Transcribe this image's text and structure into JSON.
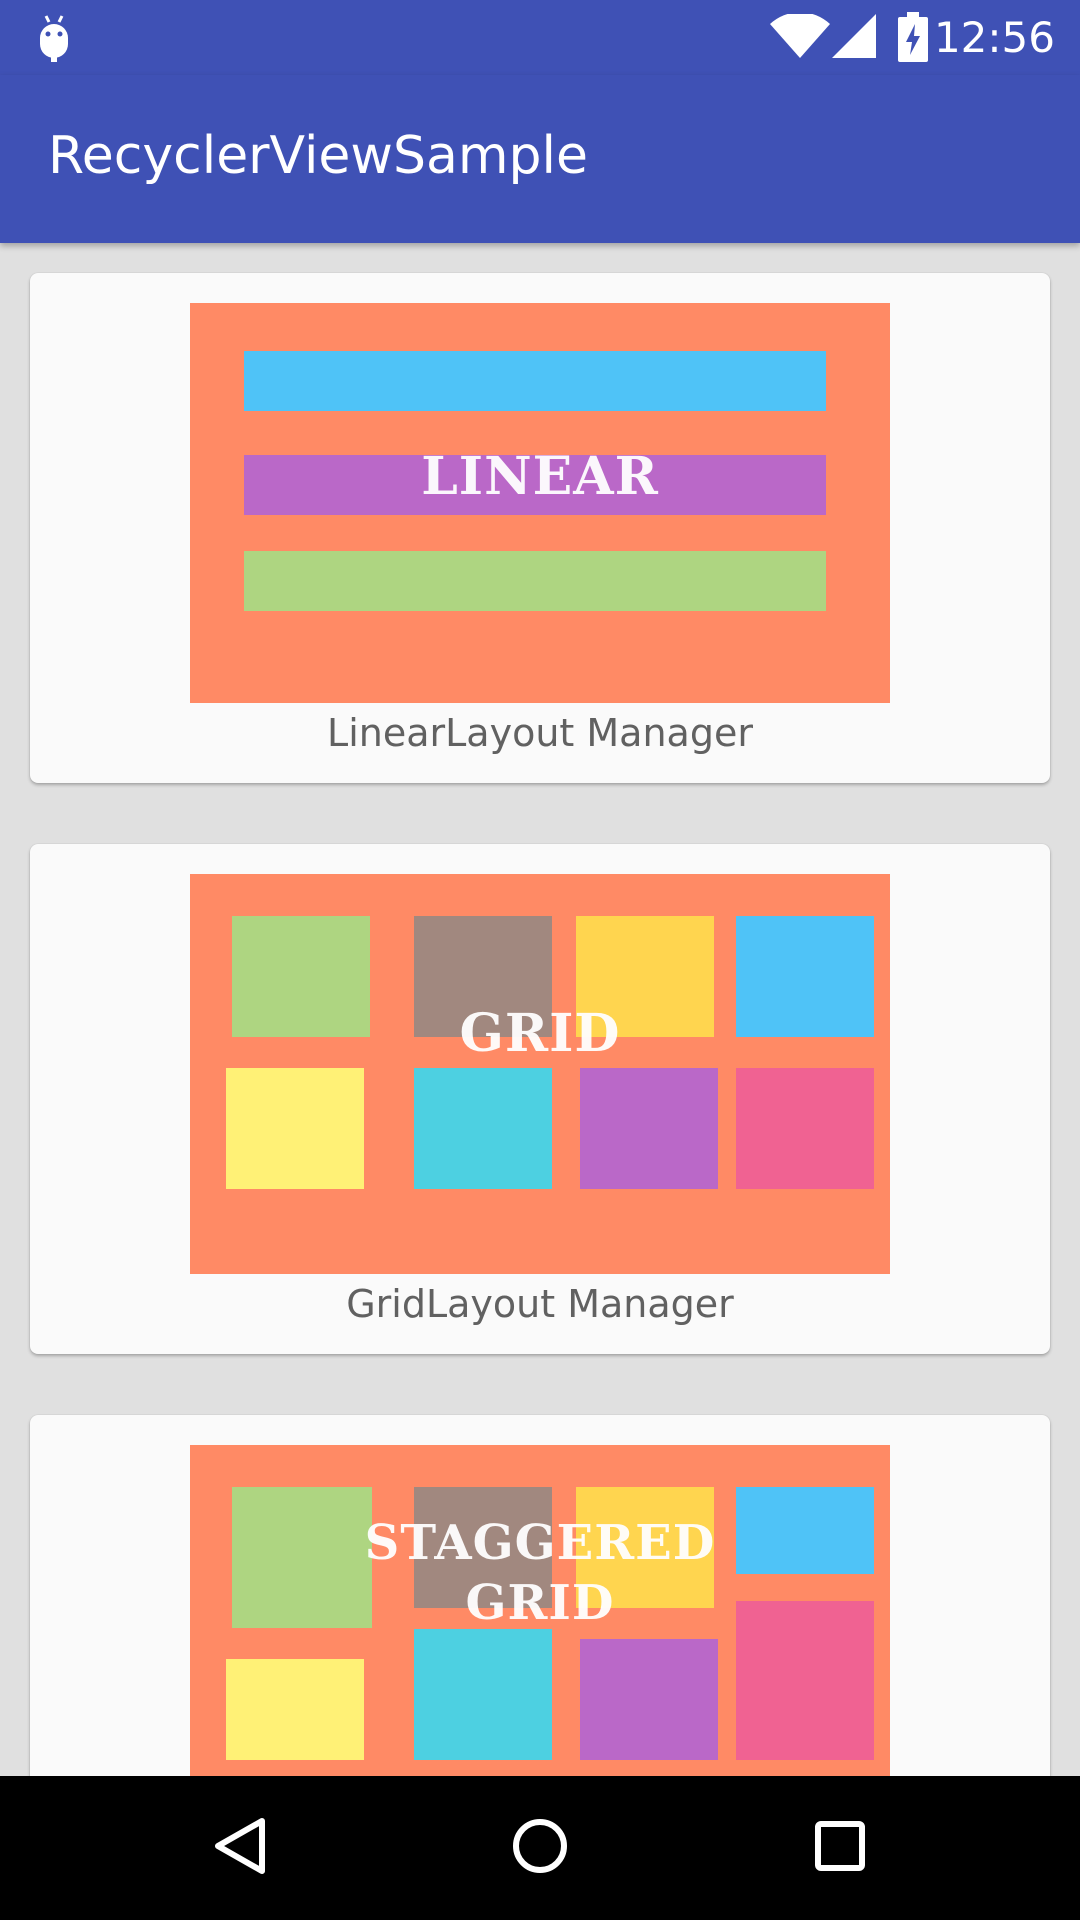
{
  "status_bar": {
    "time": "12:56",
    "icons": [
      "android-debug-icon",
      "wifi-icon",
      "cellular-signal-icon",
      "battery-charging-icon"
    ]
  },
  "app_bar": {
    "title": "RecyclerViewSample"
  },
  "cards": [
    {
      "thumbnail_label": "LINEAR",
      "caption": "LinearLayout Manager"
    },
    {
      "thumbnail_label": "GRID",
      "caption": "GridLayout Manager"
    },
    {
      "thumbnail_label_line1": "STAGGERED",
      "thumbnail_label_line2": "GRID"
    }
  ],
  "nav_bar": {
    "icons": [
      "back-triangle-icon",
      "home-circle-icon",
      "recents-square-icon"
    ]
  },
  "colors": {
    "primary": "#3f51b5",
    "thumbnail_bg": "#ff8a65",
    "blue": "#4fc3f7",
    "purple": "#ba68c8",
    "green": "#aed581",
    "brown": "#a1887f",
    "amber": "#ffd54f",
    "yellow": "#fff176",
    "cyan": "#4dd0e1",
    "pink": "#f06292",
    "caption_text": "#616161"
  }
}
